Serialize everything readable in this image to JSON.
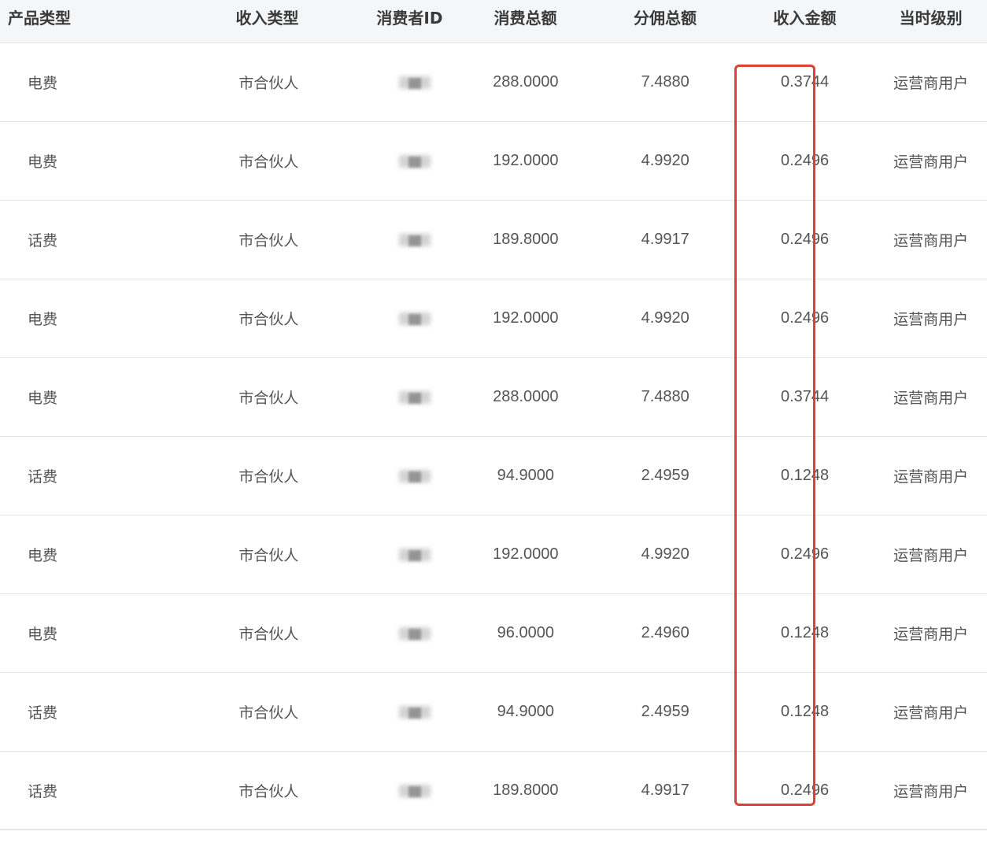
{
  "table": {
    "headers": [
      "产品类型",
      "收入类型",
      "消费者ID",
      "消费总额",
      "分佣总额",
      "收入金额",
      "当时级别"
    ],
    "rows": [
      {
        "product_type": "电费",
        "income_type": "市合伙人",
        "consumer_id": "",
        "total_spend": "288.0000",
        "total_commission": "7.4880",
        "income_amount": "0.3744",
        "level": "运营商用户"
      },
      {
        "product_type": "电费",
        "income_type": "市合伙人",
        "consumer_id": "",
        "total_spend": "192.0000",
        "total_commission": "4.9920",
        "income_amount": "0.2496",
        "level": "运营商用户"
      },
      {
        "product_type": "话费",
        "income_type": "市合伙人",
        "consumer_id": "",
        "total_spend": "189.8000",
        "total_commission": "4.9917",
        "income_amount": "0.2496",
        "level": "运营商用户"
      },
      {
        "product_type": "电费",
        "income_type": "市合伙人",
        "consumer_id": "",
        "total_spend": "192.0000",
        "total_commission": "4.9920",
        "income_amount": "0.2496",
        "level": "运营商用户"
      },
      {
        "product_type": "电费",
        "income_type": "市合伙人",
        "consumer_id": "",
        "total_spend": "288.0000",
        "total_commission": "7.4880",
        "income_amount": "0.3744",
        "level": "运营商用户"
      },
      {
        "product_type": "话费",
        "income_type": "市合伙人",
        "consumer_id": "",
        "total_spend": "94.9000",
        "total_commission": "2.4959",
        "income_amount": "0.1248",
        "level": "运营商用户"
      },
      {
        "product_type": "电费",
        "income_type": "市合伙人",
        "consumer_id": "",
        "total_spend": "192.0000",
        "total_commission": "4.9920",
        "income_amount": "0.2496",
        "level": "运营商用户"
      },
      {
        "product_type": "电费",
        "income_type": "市合伙人",
        "consumer_id": "",
        "total_spend": "96.0000",
        "total_commission": "2.4960",
        "income_amount": "0.1248",
        "level": "运营商用户"
      },
      {
        "product_type": "话费",
        "income_type": "市合伙人",
        "consumer_id": "",
        "total_spend": "94.9000",
        "total_commission": "2.4959",
        "income_amount": "0.1248",
        "level": "运营商用户"
      },
      {
        "product_type": "话费",
        "income_type": "市合伙人",
        "consumer_id": "",
        "total_spend": "189.8000",
        "total_commission": "4.9917",
        "income_amount": "0.2496",
        "level": "运营商用户"
      }
    ]
  },
  "colors": {
    "highlight_border": "#d9432f",
    "header_bg": "#f5f6f7",
    "divider": "#e6e6e6",
    "text": "#555555"
  }
}
